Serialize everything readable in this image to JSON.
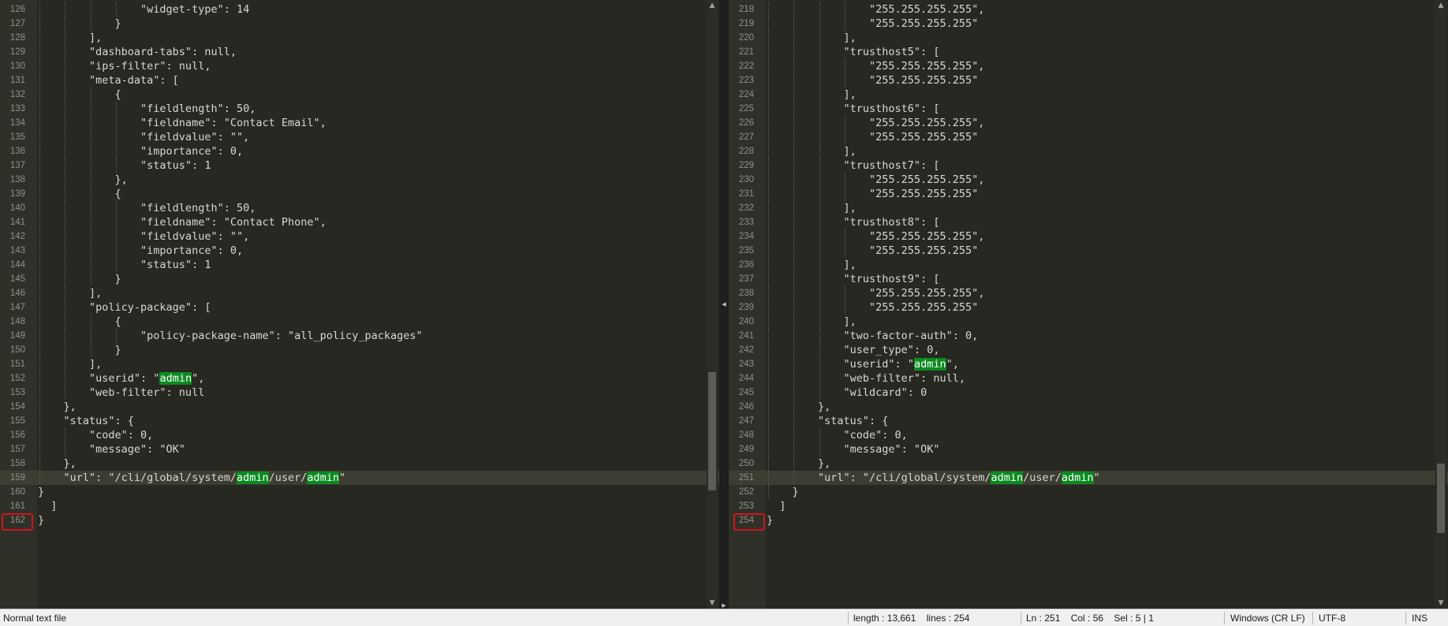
{
  "left_pane": {
    "lines": [
      {
        "n": "126",
        "t": "                \"widget-type\": 14"
      },
      {
        "n": "127",
        "t": "            }"
      },
      {
        "n": "128",
        "t": "        ],"
      },
      {
        "n": "129",
        "t": "        \"dashboard-tabs\": null,"
      },
      {
        "n": "130",
        "t": "        \"ips-filter\": null,"
      },
      {
        "n": "131",
        "t": "        \"meta-data\": ["
      },
      {
        "n": "132",
        "t": "            {"
      },
      {
        "n": "133",
        "t": "                \"fieldlength\": 50,"
      },
      {
        "n": "134",
        "t": "                \"fieldname\": \"Contact Email\","
      },
      {
        "n": "135",
        "t": "                \"fieldvalue\": \"\","
      },
      {
        "n": "136",
        "t": "                \"importance\": 0,"
      },
      {
        "n": "137",
        "t": "                \"status\": 1"
      },
      {
        "n": "138",
        "t": "            },"
      },
      {
        "n": "139",
        "t": "            {"
      },
      {
        "n": "140",
        "t": "                \"fieldlength\": 50,"
      },
      {
        "n": "141",
        "t": "                \"fieldname\": \"Contact Phone\","
      },
      {
        "n": "142",
        "t": "                \"fieldvalue\": \"\","
      },
      {
        "n": "143",
        "t": "                \"importance\": 0,"
      },
      {
        "n": "144",
        "t": "                \"status\": 1"
      },
      {
        "n": "145",
        "t": "            }"
      },
      {
        "n": "146",
        "t": "        ],"
      },
      {
        "n": "147",
        "t": "        \"policy-package\": ["
      },
      {
        "n": "148",
        "t": "            {"
      },
      {
        "n": "149",
        "t": "                \"policy-package-name\": \"all_policy_packages\""
      },
      {
        "n": "150",
        "t": "            }"
      },
      {
        "n": "151",
        "t": "        ],"
      },
      {
        "n": "152",
        "t": "        \"userid\": \"[admin]\","
      },
      {
        "n": "153",
        "t": "        \"web-filter\": null"
      },
      {
        "n": "154",
        "t": "    },"
      },
      {
        "n": "155",
        "t": "    \"status\": {"
      },
      {
        "n": "156",
        "t": "        \"code\": 0,"
      },
      {
        "n": "157",
        "t": "        \"message\": \"OK\""
      },
      {
        "n": "158",
        "t": "    },"
      },
      {
        "n": "159",
        "t": "    \"url\": \"/cli/global/system/[admin]/user/[admin]\"",
        "current": true
      },
      {
        "n": "160",
        "t": "}"
      },
      {
        "n": "161",
        "t": "  ]"
      },
      {
        "n": "162",
        "t": "}"
      }
    ]
  },
  "right_pane": {
    "lines": [
      {
        "n": "218",
        "t": "                \"255.255.255.255\","
      },
      {
        "n": "219",
        "t": "                \"255.255.255.255\""
      },
      {
        "n": "220",
        "t": "            ],"
      },
      {
        "n": "221",
        "t": "            \"trusthost5\": ["
      },
      {
        "n": "222",
        "t": "                \"255.255.255.255\","
      },
      {
        "n": "223",
        "t": "                \"255.255.255.255\""
      },
      {
        "n": "224",
        "t": "            ],"
      },
      {
        "n": "225",
        "t": "            \"trusthost6\": ["
      },
      {
        "n": "226",
        "t": "                \"255.255.255.255\","
      },
      {
        "n": "227",
        "t": "                \"255.255.255.255\""
      },
      {
        "n": "228",
        "t": "            ],"
      },
      {
        "n": "229",
        "t": "            \"trusthost7\": ["
      },
      {
        "n": "230",
        "t": "                \"255.255.255.255\","
      },
      {
        "n": "231",
        "t": "                \"255.255.255.255\""
      },
      {
        "n": "232",
        "t": "            ],"
      },
      {
        "n": "233",
        "t": "            \"trusthost8\": ["
      },
      {
        "n": "234",
        "t": "                \"255.255.255.255\","
      },
      {
        "n": "235",
        "t": "                \"255.255.255.255\""
      },
      {
        "n": "236",
        "t": "            ],"
      },
      {
        "n": "237",
        "t": "            \"trusthost9\": ["
      },
      {
        "n": "238",
        "t": "                \"255.255.255.255\","
      },
      {
        "n": "239",
        "t": "                \"255.255.255.255\""
      },
      {
        "n": "240",
        "t": "            ],"
      },
      {
        "n": "241",
        "t": "            \"two-factor-auth\": 0,"
      },
      {
        "n": "242",
        "t": "            \"user_type\": 0,"
      },
      {
        "n": "243",
        "t": "            \"userid\": \"[admin]\","
      },
      {
        "n": "244",
        "t": "            \"web-filter\": null,"
      },
      {
        "n": "245",
        "t": "            \"wildcard\": 0"
      },
      {
        "n": "246",
        "t": "        },"
      },
      {
        "n": "247",
        "t": "        \"status\": {"
      },
      {
        "n": "248",
        "t": "            \"code\": 0,"
      },
      {
        "n": "249",
        "t": "            \"message\": \"OK\""
      },
      {
        "n": "250",
        "t": "        },"
      },
      {
        "n": "251",
        "t": "        \"url\": \"/cli/global/system/[admin]/user/[admin]\"",
        "current": true
      },
      {
        "n": "252",
        "t": "    }"
      },
      {
        "n": "253",
        "t": "  ]"
      },
      {
        "n": "254",
        "t": "}"
      }
    ]
  },
  "statusbar": {
    "file_type": "Normal text file",
    "length": "length : 13,661    lines : 254",
    "position": "Ln : 251    Col : 56    Sel : 5 | 1",
    "eol": "Windows (CR LF)",
    "encoding": "UTF-8",
    "mode": "INS"
  },
  "colors": {
    "editor_bg": "#272822",
    "gutter_bg": "#2f3129",
    "highlight": "#0a8a1f",
    "marker": "#d3121c"
  }
}
